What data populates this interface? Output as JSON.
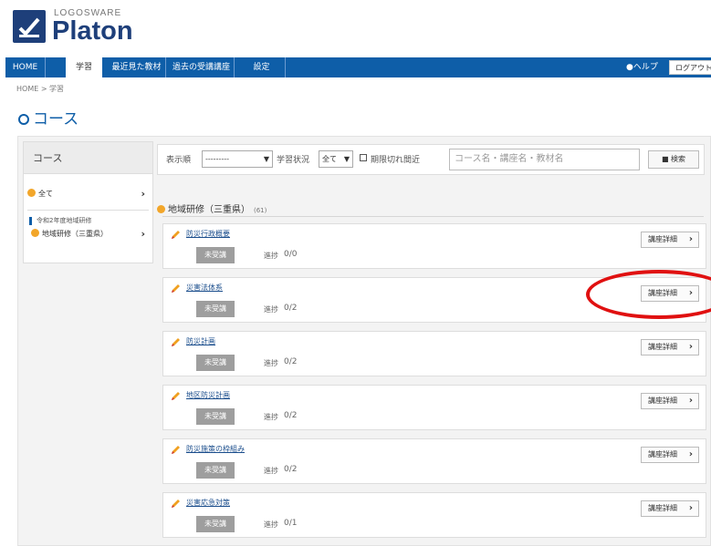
{
  "header": {
    "brand_small": "LOGOSWARE",
    "brand_name": "Platon"
  },
  "nav": {
    "items": [
      {
        "label": "HOME"
      },
      {
        "label": "学習"
      },
      {
        "label": "最近見た教材"
      },
      {
        "label": "過去の受講講座"
      },
      {
        "label": "設定"
      }
    ],
    "help_label": "ヘルプ",
    "logout_label": "ログアウト"
  },
  "breadcrumb": "HOME > 学習",
  "page_title": "コース",
  "sidebar": {
    "title": "コース",
    "all_label": "全て",
    "group_label": "令和2年度地域研修",
    "item_label": "地域研修（三重県）"
  },
  "filter": {
    "sort_label": "表示順",
    "sort_value": "---------",
    "status_label": "学習状況",
    "status_value": "全て",
    "expire_label": "期限切れ間近",
    "search_placeholder": "コース名・講座名・教材名",
    "search_button": "検索"
  },
  "category": {
    "title": "地域研修（三重県）",
    "count": "(61)"
  },
  "courses": [
    {
      "title": "防災行政概要",
      "status": "未受講",
      "progress_label": "進捗",
      "progress": "0/0",
      "detail_label": "講座詳細"
    },
    {
      "title": "災害法体系",
      "status": "未受講",
      "progress_label": "進捗",
      "progress": "0/2",
      "detail_label": "講座詳細"
    },
    {
      "title": "防災計画",
      "status": "未受講",
      "progress_label": "進捗",
      "progress": "0/2",
      "detail_label": "講座詳細"
    },
    {
      "title": "地区防災計画",
      "status": "未受講",
      "progress_label": "進捗",
      "progress": "0/2",
      "detail_label": "講座詳細"
    },
    {
      "title": "防災施策の枠組み",
      "status": "未受講",
      "progress_label": "進捗",
      "progress": "0/2",
      "detail_label": "講座詳細"
    },
    {
      "title": "災害応急対策",
      "status": "未受講",
      "progress_label": "進捗",
      "progress": "0/1",
      "detail_label": "講座詳細"
    }
  ],
  "colors": {
    "brand": "#1e3f7a",
    "nav": "#0e5ea8",
    "highlight": "#e01010"
  }
}
